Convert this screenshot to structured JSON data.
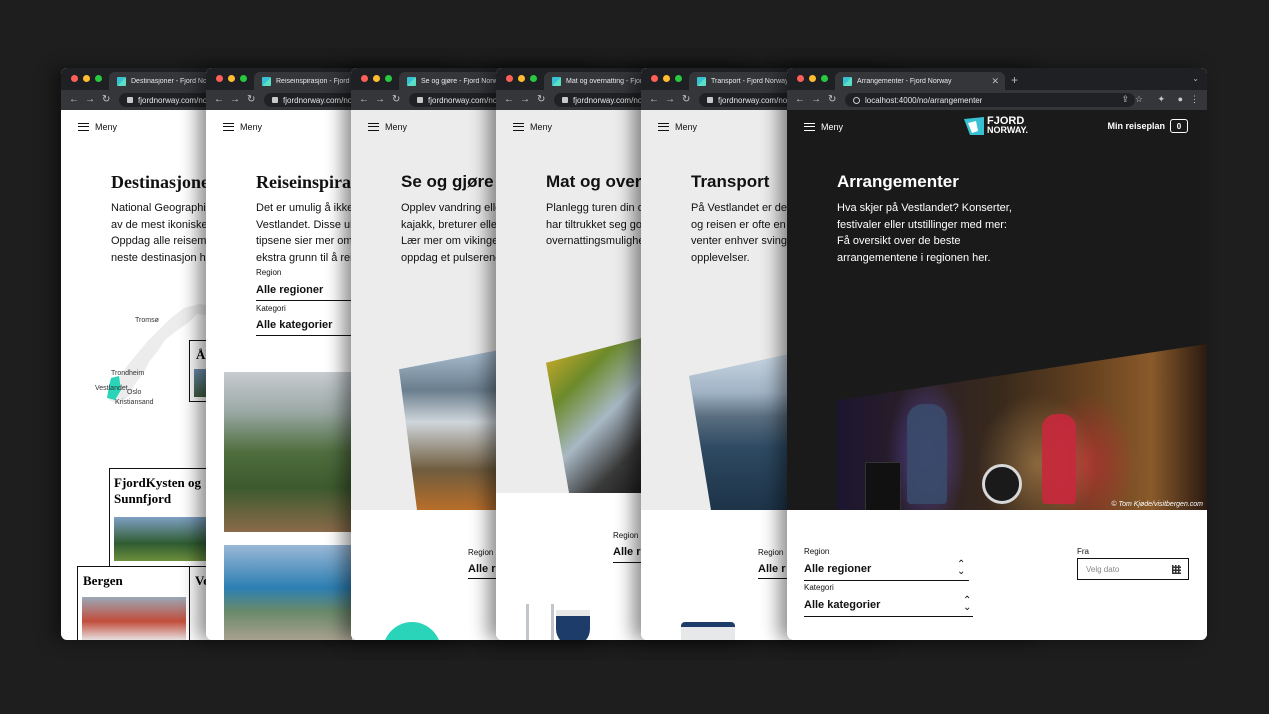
{
  "tabs_common": {
    "url_short": "fjordnorway.com/no"
  },
  "windows": [
    {
      "tab_title": "Destinasjoner - Fjord Norway",
      "url": "fjordnorway.com/no",
      "heading": "Destinasjoner",
      "intro": "National Geographic har kåret Vestlandet til et av de mest ikoniske destinasjonene i verden. Oppdag alle reisemålene i Norge og finn din neste destinasjon her i dag!",
      "map_labels": [
        "Tromsø",
        "Trondheim",
        "Vestlandet",
        "Oslo",
        "Kristiansand"
      ],
      "cards": [
        "Ål",
        "FjordKysten og Sunnfjord",
        "Bergen",
        "Ve"
      ]
    },
    {
      "tab_title": "Reiseinspirasjon - Fjord Norway",
      "url": "fjordnorway.com/no",
      "heading": "Reiseinspirasjon",
      "intro": "Det er umulig å ikke la seg inspirere av Vestlandet. Disse ubeskjedne påstandene og tipsene sier mer om hvorfor, som vil gi deg en ekstra grunn til å reise.",
      "region_label": "Region",
      "region_value": "Alle regioner",
      "category_label": "Kategori",
      "category_value": "Alle kategorier"
    },
    {
      "tab_title": "Se og gjøre - Fjord Norway",
      "url": "fjordnorway.com/no",
      "heading": "Se og gjøre",
      "intro": "Opplev vandring eller padling på Vestlandet, kajakk, breturer eller rafting – det finnes mye. Lær mer om vikinger og historie eller bare oppdag et pulserende kulturliv.",
      "region_label": "Region",
      "region_value": "Alle r"
    },
    {
      "tab_title": "Mat og overnatting - Fjord Norway",
      "url": "fjordnorway.com/no",
      "heading": "Mat og overnatting",
      "intro": "Planlegg turen din og finn de beste stedene. Vi har tiltrukket seg gode restauranter og overnattingsmuligheter.",
      "region_label": "Region",
      "region_value": "Alle r"
    },
    {
      "tab_title": "Transport - Fjord Norway",
      "url": "fjordnorway.com/no",
      "heading": "Transport",
      "intro": "På Vestlandet er det lett å komme seg rundt, og reisen er ofte en del av opplevelsen. Det venter enhver sving dukker opp nye flotte opplevelser.",
      "region_label": "Region",
      "region_value": "Alle r"
    },
    {
      "tab_title": "Arrangementer - Fjord Norway",
      "url": "localhost:4000/no/arrangementer",
      "heading": "Arrangementer",
      "intro": "Hva skjer på Vestlandet? Konserter, festivaler eller utstillinger med mer: Få oversikt over de beste arrangementene i regionen her.",
      "region_label": "Region",
      "region_value": "Alle regioner",
      "category_label": "Kategori",
      "category_value": "Alle kategorier",
      "from_label": "Fra",
      "date_placeholder": "Velg dato",
      "photo_credit": "© Tom Kjøde/visitbergen.com",
      "trip_label": "Min reiseplan",
      "trip_count": "0",
      "logo_top": "FJORD",
      "logo_bottom": "NORWAY."
    }
  ],
  "menu_label": "Meny",
  "colors": {
    "close": "#ff5f57",
    "minimize": "#febc2e",
    "zoom": "#28c840",
    "accent": "#2ad4b8",
    "dark_bg": "#1a1a1a"
  }
}
